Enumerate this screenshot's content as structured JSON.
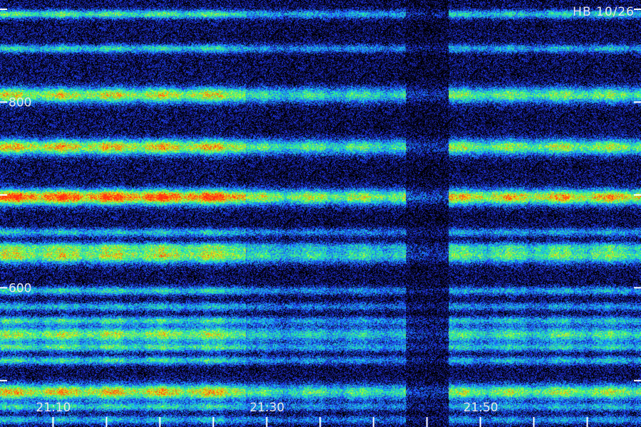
{
  "chart_data": {
    "type": "heatmap",
    "title": "",
    "annotation": "HB 10/26",
    "y_axis": {
      "ticks": [
        800,
        600
      ],
      "ylim": [
        450,
        910
      ]
    },
    "x_axis": {
      "ticks": [
        "21:10",
        "21:30",
        "21:50"
      ],
      "xlim": [
        "21:05",
        "22:05"
      ]
    },
    "colormap": [
      "#000000",
      "#1a1a8c",
      "#1f3cff",
      "#1aa8ff",
      "#20e0c0",
      "#40ff60",
      "#e0ff20",
      "#ff9a10",
      "#ff2a10"
    ],
    "bands": [
      {
        "freq": 895,
        "intensity": 0.55
      },
      {
        "freq": 858,
        "intensity": 0.45
      },
      {
        "freq": 808,
        "intensity": 0.72
      },
      {
        "freq": 752,
        "intensity": 0.78
      },
      {
        "freq": 698,
        "intensity": 0.98
      },
      {
        "freq": 660,
        "intensity": 0.42
      },
      {
        "freq": 645,
        "intensity": 0.4
      },
      {
        "freq": 635,
        "intensity": 0.7
      },
      {
        "freq": 597,
        "intensity": 0.45
      },
      {
        "freq": 580,
        "intensity": 0.4
      },
      {
        "freq": 565,
        "intensity": 0.48
      },
      {
        "freq": 550,
        "intensity": 0.65
      },
      {
        "freq": 536,
        "intensity": 0.5
      },
      {
        "freq": 522,
        "intensity": 0.48
      },
      {
        "freq": 488,
        "intensity": 0.78
      },
      {
        "freq": 472,
        "intensity": 0.45
      },
      {
        "freq": 458,
        "intensity": 0.4
      }
    ],
    "segments": [
      {
        "start": "21:05",
        "end": "21:28",
        "gain": 1.0
      },
      {
        "start": "21:28",
        "end": "21:43",
        "gain": 0.7
      },
      {
        "start": "21:43",
        "end": "21:47",
        "gain": 0.25
      },
      {
        "start": "21:47",
        "end": "21:57",
        "gain": 0.82
      },
      {
        "start": "21:57",
        "end": "22:05",
        "gain": 0.85
      }
    ]
  }
}
